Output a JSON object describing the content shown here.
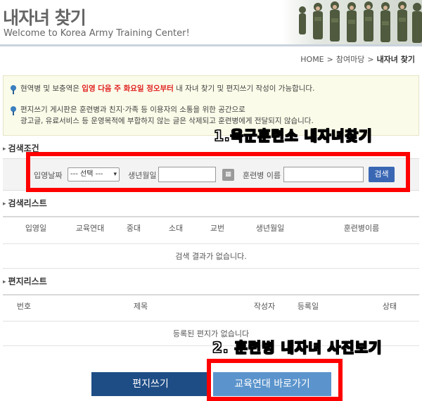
{
  "header": {
    "title": "내자녀 찾기",
    "subtitle": "Welcome to Korea Army Training Center!"
  },
  "breadcrumb": {
    "home": "HOME",
    "level1": "참여마당",
    "current": "내자녀 찾기",
    "sep": ">"
  },
  "notice": {
    "line1_before": "현역병 및 보충역은 ",
    "line1_highlight": "입영 다음 주 화요일 정오부터",
    "line1_after": " 내 자녀 찾기 및 편지쓰기 작성이 가능합니다.",
    "line2": "편지쓰기 게시판은 훈련병과 친지·가족 등 이용자의 소통을 위한 공간으로",
    "line3": "광고글, 유료서비스 등 운영목적에 부합하지 않는 글은 삭제되고 훈련병에게 전달되지 않습니다."
  },
  "annotations": {
    "first": "1.육군훈련소 내자녀찾기",
    "second": "2. 훈련병 내자녀 사진보기"
  },
  "search": {
    "section_title": "검색조건",
    "enlist_date_label": "입영날짜",
    "enlist_date_value": "--- 선택 ---",
    "birth_label": "생년월일",
    "name_label": "훈련병 이름",
    "search_button": "검색"
  },
  "results": {
    "section_title": "검색리스트",
    "columns": [
      "입영일",
      "교육연대",
      "중대",
      "소대",
      "교번",
      "생년월일",
      "훈련병이름"
    ],
    "empty_text": "검색 결과가 없습니다."
  },
  "letters": {
    "section_title": "편지리스트",
    "columns": [
      "번호",
      "제목",
      "작성자",
      "등록일",
      "상태"
    ],
    "empty_text": "등록된 편지가 없습니다"
  },
  "buttons": {
    "write_letter": "편지쓰기",
    "go_regiment": "교육연대 바로가기"
  },
  "colors": {
    "accent_blue": "#3a67b4",
    "dark_blue": "#1e4d86",
    "light_blue": "#5b94cc",
    "highlight_red": "#e02020",
    "annotation_box": "#ff0000"
  }
}
